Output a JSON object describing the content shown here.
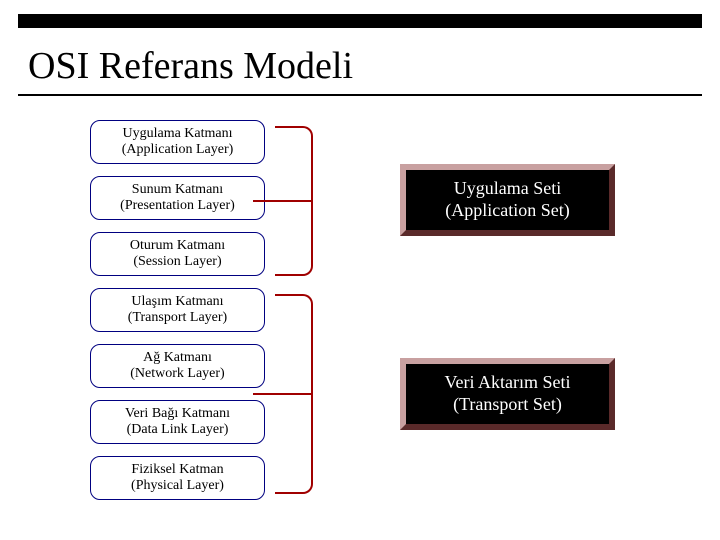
{
  "title": "OSI Referans Modeli",
  "layers": [
    {
      "name_tr": "Uygulama Katmanı",
      "name_en": "(Application Layer)"
    },
    {
      "name_tr": "Sunum Katmanı",
      "name_en": "(Presentation Layer)"
    },
    {
      "name_tr": "Oturum Katmanı",
      "name_en": "(Session Layer)"
    },
    {
      "name_tr": "Ulaşım Katmanı",
      "name_en": "(Transport Layer)"
    },
    {
      "name_tr": "Ağ Katmanı",
      "name_en": "(Network Layer)"
    },
    {
      "name_tr": "Veri Bağı Katmanı",
      "name_en": "(Data Link Layer)"
    },
    {
      "name_tr": "Fiziksel Katman",
      "name_en": "(Physical Layer)"
    }
  ],
  "groups": [
    {
      "label_tr": "Uygulama Seti",
      "label_en": "(Application Set)",
      "covers": [
        0,
        1,
        2
      ]
    },
    {
      "label_tr": "Veri Aktarım Seti",
      "label_en": "(Transport Set)",
      "covers": [
        3,
        4,
        5,
        6
      ]
    }
  ],
  "colors": {
    "layer_border": "#000080",
    "bracket": "#a00000",
    "setbox_bg": "#000000",
    "setbox_hilite": "#c8a0a0",
    "setbox_shadow": "#5a2a2a"
  }
}
